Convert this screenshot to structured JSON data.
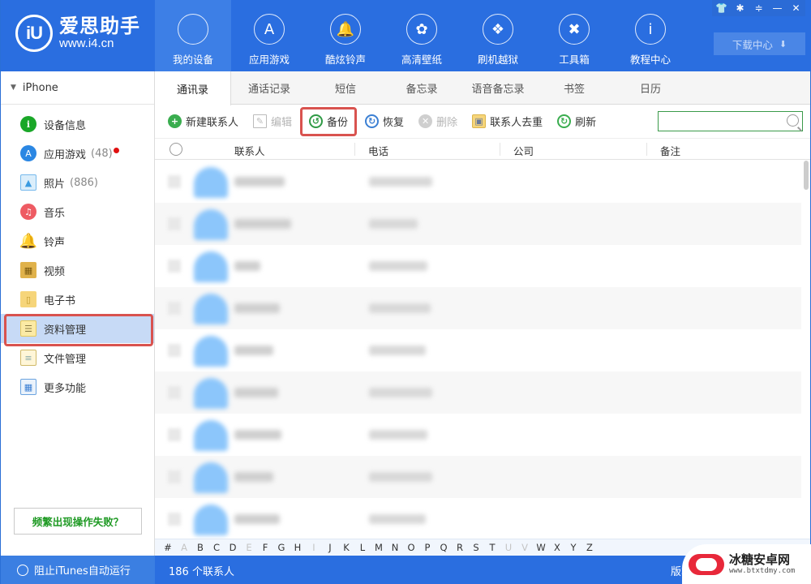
{
  "app": {
    "logo_title": "爱思助手",
    "logo_url": "www.i4.cn",
    "logo_mark": "iU"
  },
  "nav": [
    {
      "label": "我的设备",
      "icon": "apple-icon",
      "glyph": "",
      "active": true
    },
    {
      "label": "应用游戏",
      "icon": "app-store-icon",
      "glyph": "A"
    },
    {
      "label": "酷炫铃声",
      "icon": "bell-icon",
      "glyph": "🔔"
    },
    {
      "label": "高清壁纸",
      "icon": "flower-icon",
      "glyph": "✿"
    },
    {
      "label": "刷机越狱",
      "icon": "dropbox-icon",
      "glyph": "❖"
    },
    {
      "label": "工具箱",
      "icon": "tools-icon",
      "glyph": "✖"
    },
    {
      "label": "教程中心",
      "icon": "info-icon",
      "glyph": "i"
    }
  ],
  "window_controls": [
    {
      "name": "skin-icon",
      "glyph": "👕"
    },
    {
      "name": "settings-icon",
      "glyph": "✱"
    },
    {
      "name": "menu-icon",
      "glyph": "≑"
    },
    {
      "name": "minimize-icon",
      "glyph": "—"
    },
    {
      "name": "close-icon",
      "glyph": "✕"
    }
  ],
  "download_center": {
    "label": "下载中心",
    "glyph": "⬇"
  },
  "sidebar": {
    "device": "iPhone",
    "items": [
      {
        "label": "设备信息",
        "icon": "info-icon",
        "glyph": "i",
        "cls": "ic-info"
      },
      {
        "label": "应用游戏",
        "count": "(48)",
        "badge": true,
        "icon": "app-store-icon",
        "glyph": "A",
        "cls": "ic-app"
      },
      {
        "label": "照片",
        "count": "(886)",
        "icon": "photo-icon",
        "glyph": "▲",
        "cls": "ic-photo"
      },
      {
        "label": "音乐",
        "icon": "music-icon",
        "glyph": "♫",
        "cls": "ic-music"
      },
      {
        "label": "铃声",
        "icon": "bell-icon",
        "glyph": "🔔",
        "cls": "ic-bell"
      },
      {
        "label": "视频",
        "icon": "video-icon",
        "glyph": "▦",
        "cls": "ic-video"
      },
      {
        "label": "电子书",
        "icon": "book-icon",
        "glyph": "▯",
        "cls": "ic-book"
      },
      {
        "label": "资料管理",
        "icon": "data-management-icon",
        "glyph": "☰",
        "cls": "ic-data",
        "active": true
      },
      {
        "label": "文件管理",
        "icon": "file-icon",
        "glyph": "≡",
        "cls": "ic-file"
      },
      {
        "label": "更多功能",
        "icon": "grid-icon",
        "glyph": "▦",
        "cls": "ic-more"
      }
    ],
    "help_button": "频繁出现操作失败？"
  },
  "tabs": [
    {
      "label": "通讯录",
      "active": true
    },
    {
      "label": "通话记录"
    },
    {
      "label": "短信"
    },
    {
      "label": "备忘录"
    },
    {
      "label": "语音备忘录"
    },
    {
      "label": "书签"
    },
    {
      "label": "日历"
    }
  ],
  "toolbar": {
    "buttons": [
      {
        "label": "新建联系人",
        "name": "new-contact-button",
        "icon": "add-icon",
        "glyph": "+",
        "cls": "i-add"
      },
      {
        "label": "编辑",
        "name": "edit-button",
        "icon": "edit-icon",
        "glyph": "✎",
        "cls": "i-edit",
        "disabled": true
      },
      {
        "label": "备份",
        "name": "backup-button",
        "icon": "backup-icon",
        "glyph": "↺",
        "cls": "i-backup",
        "highlight": true
      },
      {
        "label": "恢复",
        "name": "restore-button",
        "icon": "restore-icon",
        "glyph": "↻",
        "cls": "i-restore"
      },
      {
        "label": "删除",
        "name": "delete-button",
        "icon": "delete-icon",
        "glyph": "✕",
        "cls": "i-del",
        "disabled": true
      },
      {
        "label": "联系人去重",
        "name": "dedupe-button",
        "icon": "dedupe-icon",
        "glyph": "▣",
        "cls": "i-dedup"
      },
      {
        "label": "刷新",
        "name": "refresh-button",
        "icon": "refresh-icon",
        "glyph": "↻",
        "cls": "i-refresh"
      }
    ],
    "search_value": "",
    "search_placeholder": ""
  },
  "table": {
    "columns": [
      "联系人",
      "电话",
      "公司",
      "备注"
    ],
    "rows_note": "contact rows are blurred (not readable)",
    "visible_row_count": 9
  },
  "alphabet": [
    {
      "l": "#"
    },
    {
      "l": "A",
      "dim": true
    },
    {
      "l": "B"
    },
    {
      "l": "C"
    },
    {
      "l": "D"
    },
    {
      "l": "E",
      "dim": true
    },
    {
      "l": "F"
    },
    {
      "l": "G"
    },
    {
      "l": "H"
    },
    {
      "l": "I",
      "dim": true
    },
    {
      "l": "J"
    },
    {
      "l": "K"
    },
    {
      "l": "L"
    },
    {
      "l": "M"
    },
    {
      "l": "N"
    },
    {
      "l": "O"
    },
    {
      "l": "P"
    },
    {
      "l": "Q"
    },
    {
      "l": "R"
    },
    {
      "l": "S"
    },
    {
      "l": "T"
    },
    {
      "l": "U",
      "dim": true
    },
    {
      "l": "V",
      "dim": true
    },
    {
      "l": "W"
    },
    {
      "l": "X"
    },
    {
      "l": "Y"
    },
    {
      "l": "Z"
    }
  ],
  "status": {
    "itunes_label": "阻止iTunes自动运行",
    "contact_count": "186 个联系人",
    "version_label": "版本号"
  },
  "watermark": {
    "title": "冰糖安卓网",
    "url": "www.btxtdmy.com"
  },
  "colors": {
    "brand_blue": "#2a6ee0",
    "highlight_red": "#d9534f",
    "active_sidebar": "#c7daf6",
    "help_green": "#1f9a24"
  }
}
